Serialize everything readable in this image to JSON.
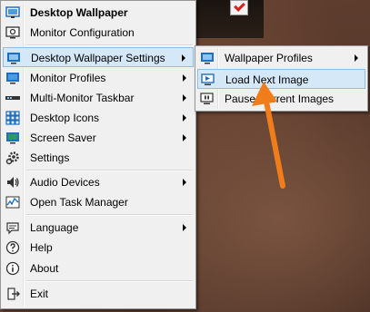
{
  "main_menu": {
    "items": [
      {
        "label": "Desktop Wallpaper",
        "icon": "wallpaper-icon",
        "bold": true
      },
      {
        "label": "Monitor Configuration",
        "icon": "monitor-config-icon"
      },
      {
        "label": "Desktop Wallpaper Settings",
        "icon": "wallpaper-settings-icon",
        "submenu": true
      },
      {
        "label": "Monitor Profiles",
        "icon": "monitor-profiles-icon",
        "submenu": true
      },
      {
        "label": "Multi-Monitor Taskbar",
        "icon": "taskbar-icon",
        "submenu": true
      },
      {
        "label": "Desktop Icons",
        "icon": "desktop-icons-icon",
        "submenu": true
      },
      {
        "label": "Screen Saver",
        "icon": "screen-saver-icon",
        "submenu": true
      },
      {
        "label": "Settings",
        "icon": "gear-icon"
      },
      {
        "label": "Audio Devices",
        "icon": "speaker-icon",
        "submenu": true
      },
      {
        "label": "Open Task Manager",
        "icon": "task-manager-icon"
      },
      {
        "label": "Language",
        "icon": "language-icon",
        "submenu": true
      },
      {
        "label": "Help",
        "icon": "help-icon"
      },
      {
        "label": "About",
        "icon": "info-icon"
      },
      {
        "label": "Exit",
        "icon": "exit-icon"
      }
    ]
  },
  "submenu": {
    "items": [
      {
        "label": "Wallpaper Profiles",
        "icon": "wallpaper-profiles-icon",
        "submenu": true
      },
      {
        "label": "Load Next Image",
        "icon": "load-next-image-icon"
      },
      {
        "label": "Pause Current Images",
        "icon": "pause-images-icon"
      }
    ]
  },
  "colors": {
    "menu_bg": "#f0f0f0",
    "highlight_bg": "#d5e8f8",
    "highlight_border": "#8fbde6",
    "annotation_arrow": "#f07d1a",
    "icon_blue": "#1e6fbf"
  }
}
